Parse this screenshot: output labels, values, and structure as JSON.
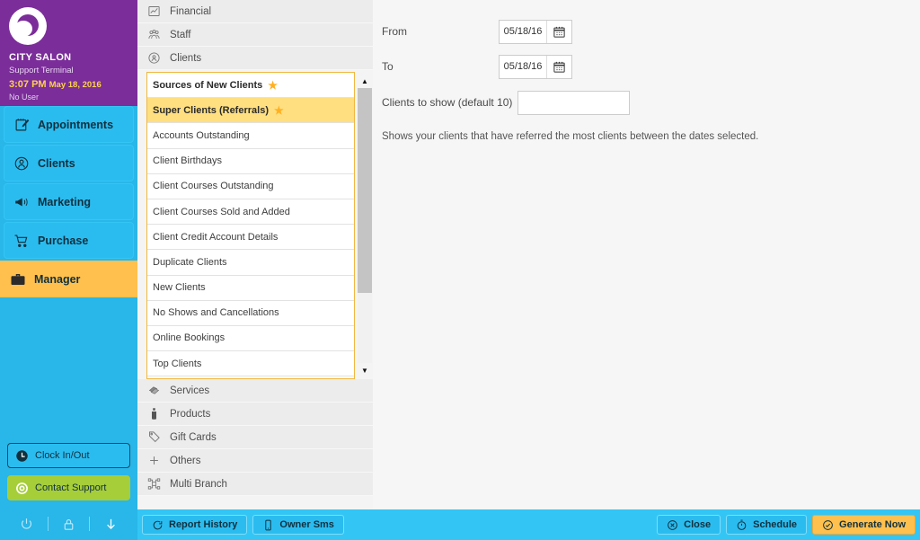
{
  "brand": {
    "salon_name": "CITY SALON",
    "terminal": "Support Terminal",
    "time": "3:07 PM",
    "date": "May 18, 2016",
    "user": "No User",
    "logo_icon": "moon-logo-icon",
    "bg_color": "#7b2d99"
  },
  "sidebar": {
    "accent_color": "#29b6e8",
    "active_color": "#ffc04d",
    "items": [
      {
        "label": "Appointments",
        "icon": "appointments-icon",
        "active": false
      },
      {
        "label": "Clients",
        "icon": "clients-icon",
        "active": false
      },
      {
        "label": "Marketing",
        "icon": "marketing-megaphone-icon",
        "active": false
      },
      {
        "label": "Purchase",
        "icon": "purchase-cart-icon",
        "active": false
      },
      {
        "label": "Manager",
        "icon": "manager-briefcase-icon",
        "active": true
      }
    ],
    "clock_button": {
      "label": "Clock In/Out",
      "icon": "clock-icon"
    },
    "support_button": {
      "label": "Contact Support",
      "icon": "support-lifering-icon",
      "color": "#a6ce39"
    },
    "system_icons": [
      {
        "name": "power-icon"
      },
      {
        "name": "lock-icon"
      },
      {
        "name": "download-arrow-icon"
      }
    ]
  },
  "report_categories_top": [
    {
      "label": "Financial",
      "icon": "chart-icon"
    },
    {
      "label": "Staff",
      "icon": "staff-group-icon"
    },
    {
      "label": "Clients",
      "icon": "client-person-icon"
    }
  ],
  "report_categories_bottom": [
    {
      "label": "Services",
      "icon": "services-icon"
    },
    {
      "label": "Products",
      "icon": "products-bottle-icon"
    },
    {
      "label": "Gift Cards",
      "icon": "gift-card-tag-icon"
    },
    {
      "label": "Others",
      "icon": "plus-icon"
    },
    {
      "label": "Multi Branch",
      "icon": "multi-branch-icon"
    }
  ],
  "report_list": {
    "border_color": "#f0b840",
    "selected_color": "#ffdf80",
    "star_color": "#ffb020",
    "items": [
      {
        "label": "Sources of New Clients",
        "starred": true,
        "selected": false
      },
      {
        "label": "Super Clients (Referrals)",
        "starred": true,
        "selected": true
      },
      {
        "label": "Accounts Outstanding",
        "starred": false,
        "selected": false
      },
      {
        "label": "Client Birthdays",
        "starred": false,
        "selected": false
      },
      {
        "label": "Client Courses Outstanding",
        "starred": false,
        "selected": false
      },
      {
        "label": "Client Courses Sold and Added",
        "starred": false,
        "selected": false
      },
      {
        "label": "Client Credit Account Details",
        "starred": false,
        "selected": false
      },
      {
        "label": "Duplicate Clients",
        "starred": false,
        "selected": false
      },
      {
        "label": "New Clients",
        "starred": false,
        "selected": false
      },
      {
        "label": "No Shows and Cancellations",
        "starred": false,
        "selected": false
      },
      {
        "label": "Online Bookings",
        "starred": false,
        "selected": false
      },
      {
        "label": "Top Clients",
        "starred": false,
        "selected": false
      }
    ]
  },
  "scrollbar": {
    "up_glyph": "▲",
    "down_glyph": "▼"
  },
  "options": {
    "from_label": "From",
    "from_value": "05/18/16",
    "to_label": "To",
    "to_value": "05/18/16",
    "clients_label": "Clients to show (default 10)",
    "clients_value": "",
    "clients_placeholder": "",
    "calendar_icon": "calendar-icon",
    "description": "Shows your clients that have referred the most clients between the dates selected."
  },
  "bottombar": {
    "report_history": {
      "label": "Report History",
      "icon": "history-refresh-icon"
    },
    "owner_sms": {
      "label": "Owner Sms",
      "icon": "phone-icon"
    },
    "close": {
      "label": "Close",
      "icon": "close-x-circle-icon"
    },
    "schedule": {
      "label": "Schedule",
      "icon": "stopwatch-icon"
    },
    "generate": {
      "label": "Generate Now",
      "icon": "check-circle-icon"
    }
  }
}
